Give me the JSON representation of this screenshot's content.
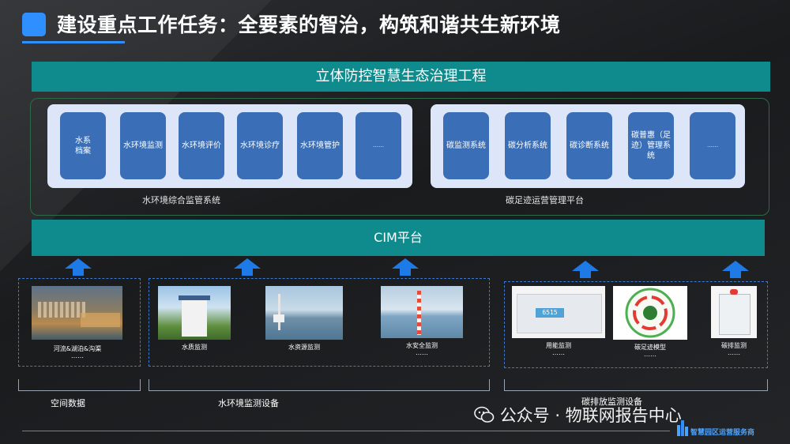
{
  "title": "建设重点工作任务：全要素的智治，构筑和谐共生新环境",
  "top_bar": "立体防控智慧生态治理工程",
  "water_system": {
    "caption": "水环境综合监管系统",
    "modules": [
      "水系\n档案",
      "水环境监测",
      "水环境评价",
      "水环境诊疗",
      "水环境管护",
      "……"
    ]
  },
  "carbon_system": {
    "caption": "碳足迹运营管理平台",
    "modules": [
      "碳监测系统",
      "碳分析系统",
      "碳诊断系统",
      "碳普惠（足迹）管理系统",
      "……"
    ]
  },
  "cim_bar": "CIM平台",
  "devices": {
    "space": {
      "label": "河流&湖泊&沟渠",
      "more": "……"
    },
    "water_quality": {
      "label": "水质监测"
    },
    "water_resource": {
      "label": "水资源监测"
    },
    "water_safety": {
      "label": "水安全监测",
      "more": "……"
    },
    "energy": {
      "label": "用能监测",
      "more": "……"
    },
    "carbon_footprint": {
      "label": "碳足迹模型",
      "more": "……"
    },
    "emission": {
      "label": "碳排监测",
      "more": "……"
    },
    "meter_display": "6515"
  },
  "groups": {
    "space": "空间数据",
    "water": "水环境监测设备",
    "carbon": "碳排放监测设备"
  },
  "footer": {
    "wechat": "公众号 · 物联网报告中心",
    "logo": "智慧园区运营服务商"
  },
  "colors": {
    "accent": "#2f8fff",
    "bar": "#0f8b8d",
    "module": "#3a6fb8",
    "panel": "#dde6f8"
  }
}
